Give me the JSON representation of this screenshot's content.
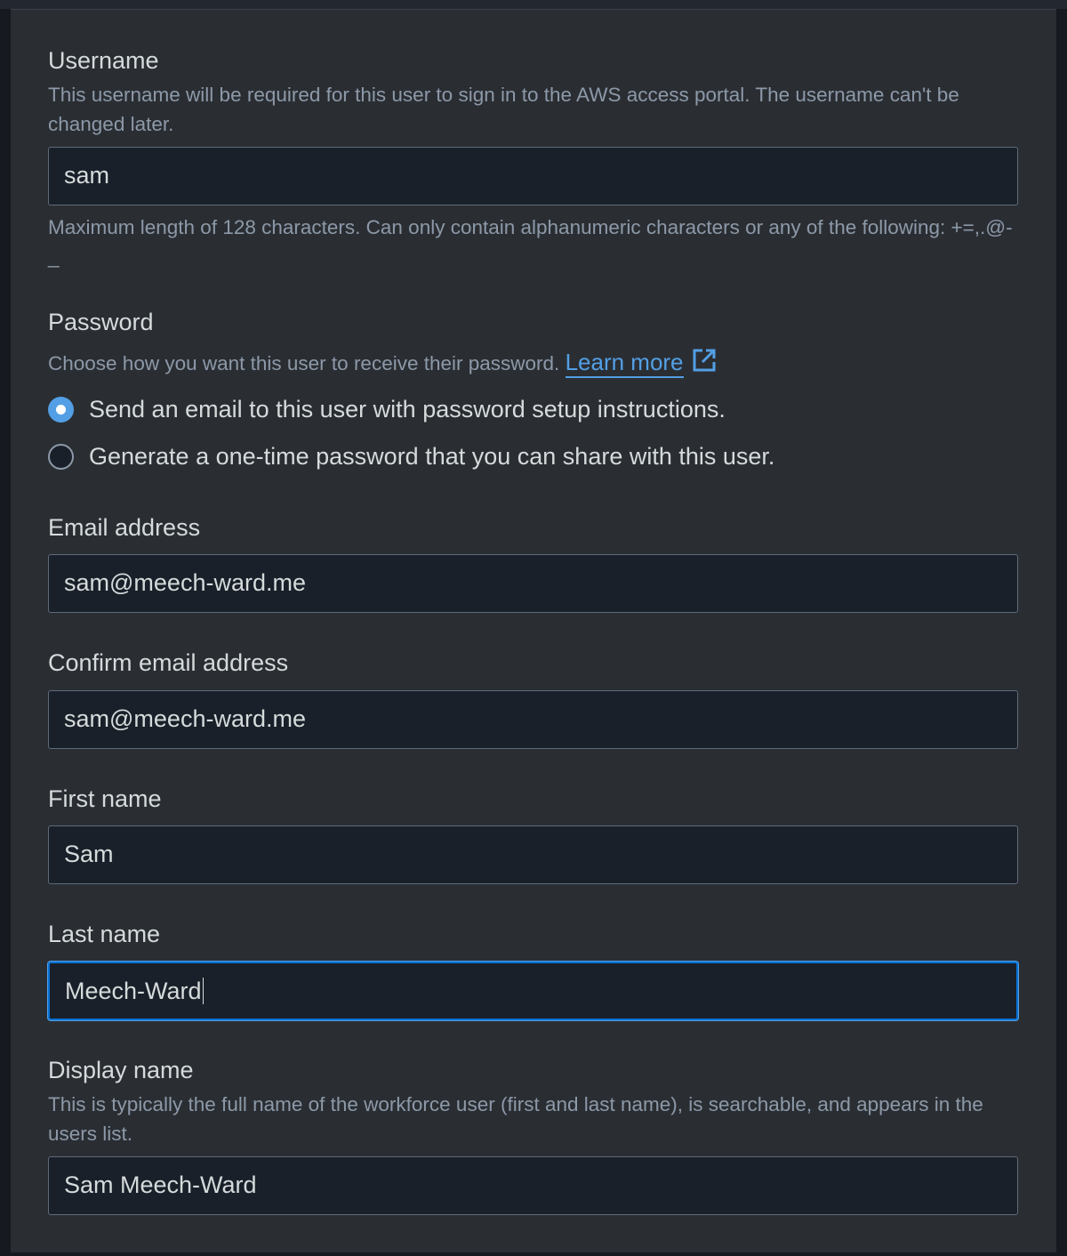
{
  "username": {
    "label": "Username",
    "description": "This username will be required for this user to sign in to the AWS access portal. The username can't be changed later.",
    "value": "sam",
    "constraint": "Maximum length of 128 characters. Can only contain alphanumeric characters or any of the following: +=,.@-_"
  },
  "password": {
    "label": "Password",
    "description": "Choose how you want this user to receive their password.",
    "learn_more": "Learn more",
    "options": [
      {
        "label": "Send an email to this user with password setup instructions.",
        "checked": true
      },
      {
        "label": "Generate a one-time password that you can share with this user.",
        "checked": false
      }
    ]
  },
  "email": {
    "label": "Email address",
    "value": "sam@meech-ward.me"
  },
  "confirm_email": {
    "label": "Confirm email address",
    "value": "sam@meech-ward.me"
  },
  "first_name": {
    "label": "First name",
    "value": "Sam"
  },
  "last_name": {
    "label": "Last name",
    "value": "Meech-Ward"
  },
  "display_name": {
    "label": "Display name",
    "description": "This is typically the full name of the workforce user (first and last name), is searchable, and appears in the users list.",
    "value": "Sam Meech-Ward"
  },
  "colors": {
    "accent": "#539fe5",
    "focus_border": "#0972d3",
    "panel_bg": "#2a2e33",
    "input_bg": "#1a2029"
  },
  "icons": {
    "external_link": "external-link-icon"
  }
}
